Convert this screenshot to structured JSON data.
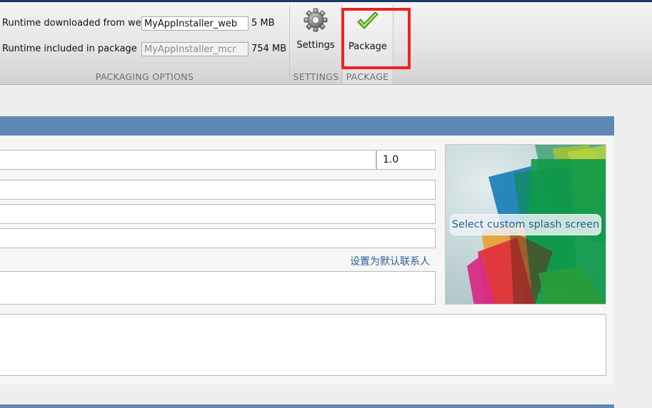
{
  "packaging": {
    "web_label": "Runtime downloaded from web",
    "web_value": "MyAppInstaller_web",
    "web_size": "5 MB",
    "pkg_label": "Runtime included in package",
    "pkg_value": "MyAppInstaller_mcr",
    "pkg_size": "754 MB",
    "section": "PACKAGING OPTIONS"
  },
  "settings": {
    "label": "Settings",
    "section": "SETTINGS"
  },
  "package": {
    "label": "Package",
    "section": "PACKAGE"
  },
  "form": {
    "version": "1.0",
    "set_default_link": "设置为默认联系人"
  },
  "splash": {
    "button_label": "Select custom splash screen"
  },
  "colors": {
    "accent": "#5e87b3",
    "highlight": "#ee2222",
    "check": "#6cbf2a"
  }
}
